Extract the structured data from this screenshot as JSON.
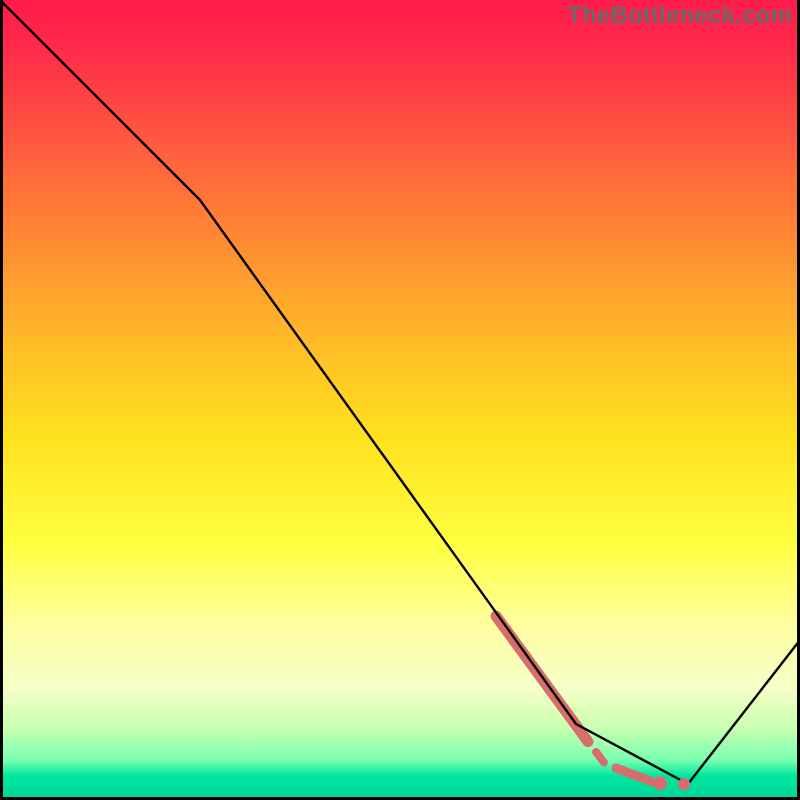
{
  "watermark": "TheBottleneck.com",
  "chart_data": {
    "type": "line",
    "title": "",
    "xlabel": "",
    "ylabel": "",
    "xlim": [
      0,
      100
    ],
    "ylim": [
      0,
      100
    ],
    "grid": false,
    "series": [
      {
        "name": "curve",
        "color": "#000000",
        "x": [
          0,
          25,
          72,
          86,
          100
        ],
        "values": [
          100,
          75,
          9.5,
          2,
          20
        ]
      }
    ],
    "segments": [
      {
        "x_start": 62,
        "y_start": 23,
        "x_end": 73.5,
        "y_end": 7.3,
        "thickness": 11,
        "color": "#d76e6c"
      },
      {
        "x_start": 74.5,
        "y_start": 6,
        "x_end": 75.5,
        "y_end": 4.7,
        "thickness": 8,
        "color": "#d76e6c"
      },
      {
        "x_start": 77,
        "y_start": 4,
        "x_end": 81.5,
        "y_end": 2.3,
        "thickness": 9,
        "color": "#d76e6c"
      }
    ],
    "dots": [
      {
        "x": 82.5,
        "y": 2.1,
        "r": 7,
        "color": "#d76e6c"
      },
      {
        "x": 85.5,
        "y": 2,
        "r": 6,
        "color": "#d76e6c"
      }
    ]
  }
}
